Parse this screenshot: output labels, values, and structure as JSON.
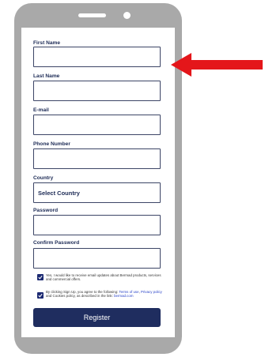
{
  "form": {
    "first_name": "First Name",
    "last_name": "Last Name",
    "email": "E-mail",
    "phone": "Phone Number",
    "country": "Country",
    "country_select": "Select Country",
    "password": "Password",
    "confirm_password": "Confirm Password",
    "consent_updates": "Yes, I would like to receive email updates about Bermad products, services and commercial offers.",
    "terms_prefix": "By clicking Sign Up, you agree to the following: ",
    "terms_link": "Terms of use",
    "terms_sep": ", ",
    "privacy_link": "Privacy policy",
    "terms_mid": " and Cookies policy, as described in the link: ",
    "site_link": "bermad.com",
    "register": "Register"
  },
  "colors": {
    "accent": "#1f2d5f",
    "arrow": "#e4161a",
    "frame": "#a9a9a9"
  }
}
